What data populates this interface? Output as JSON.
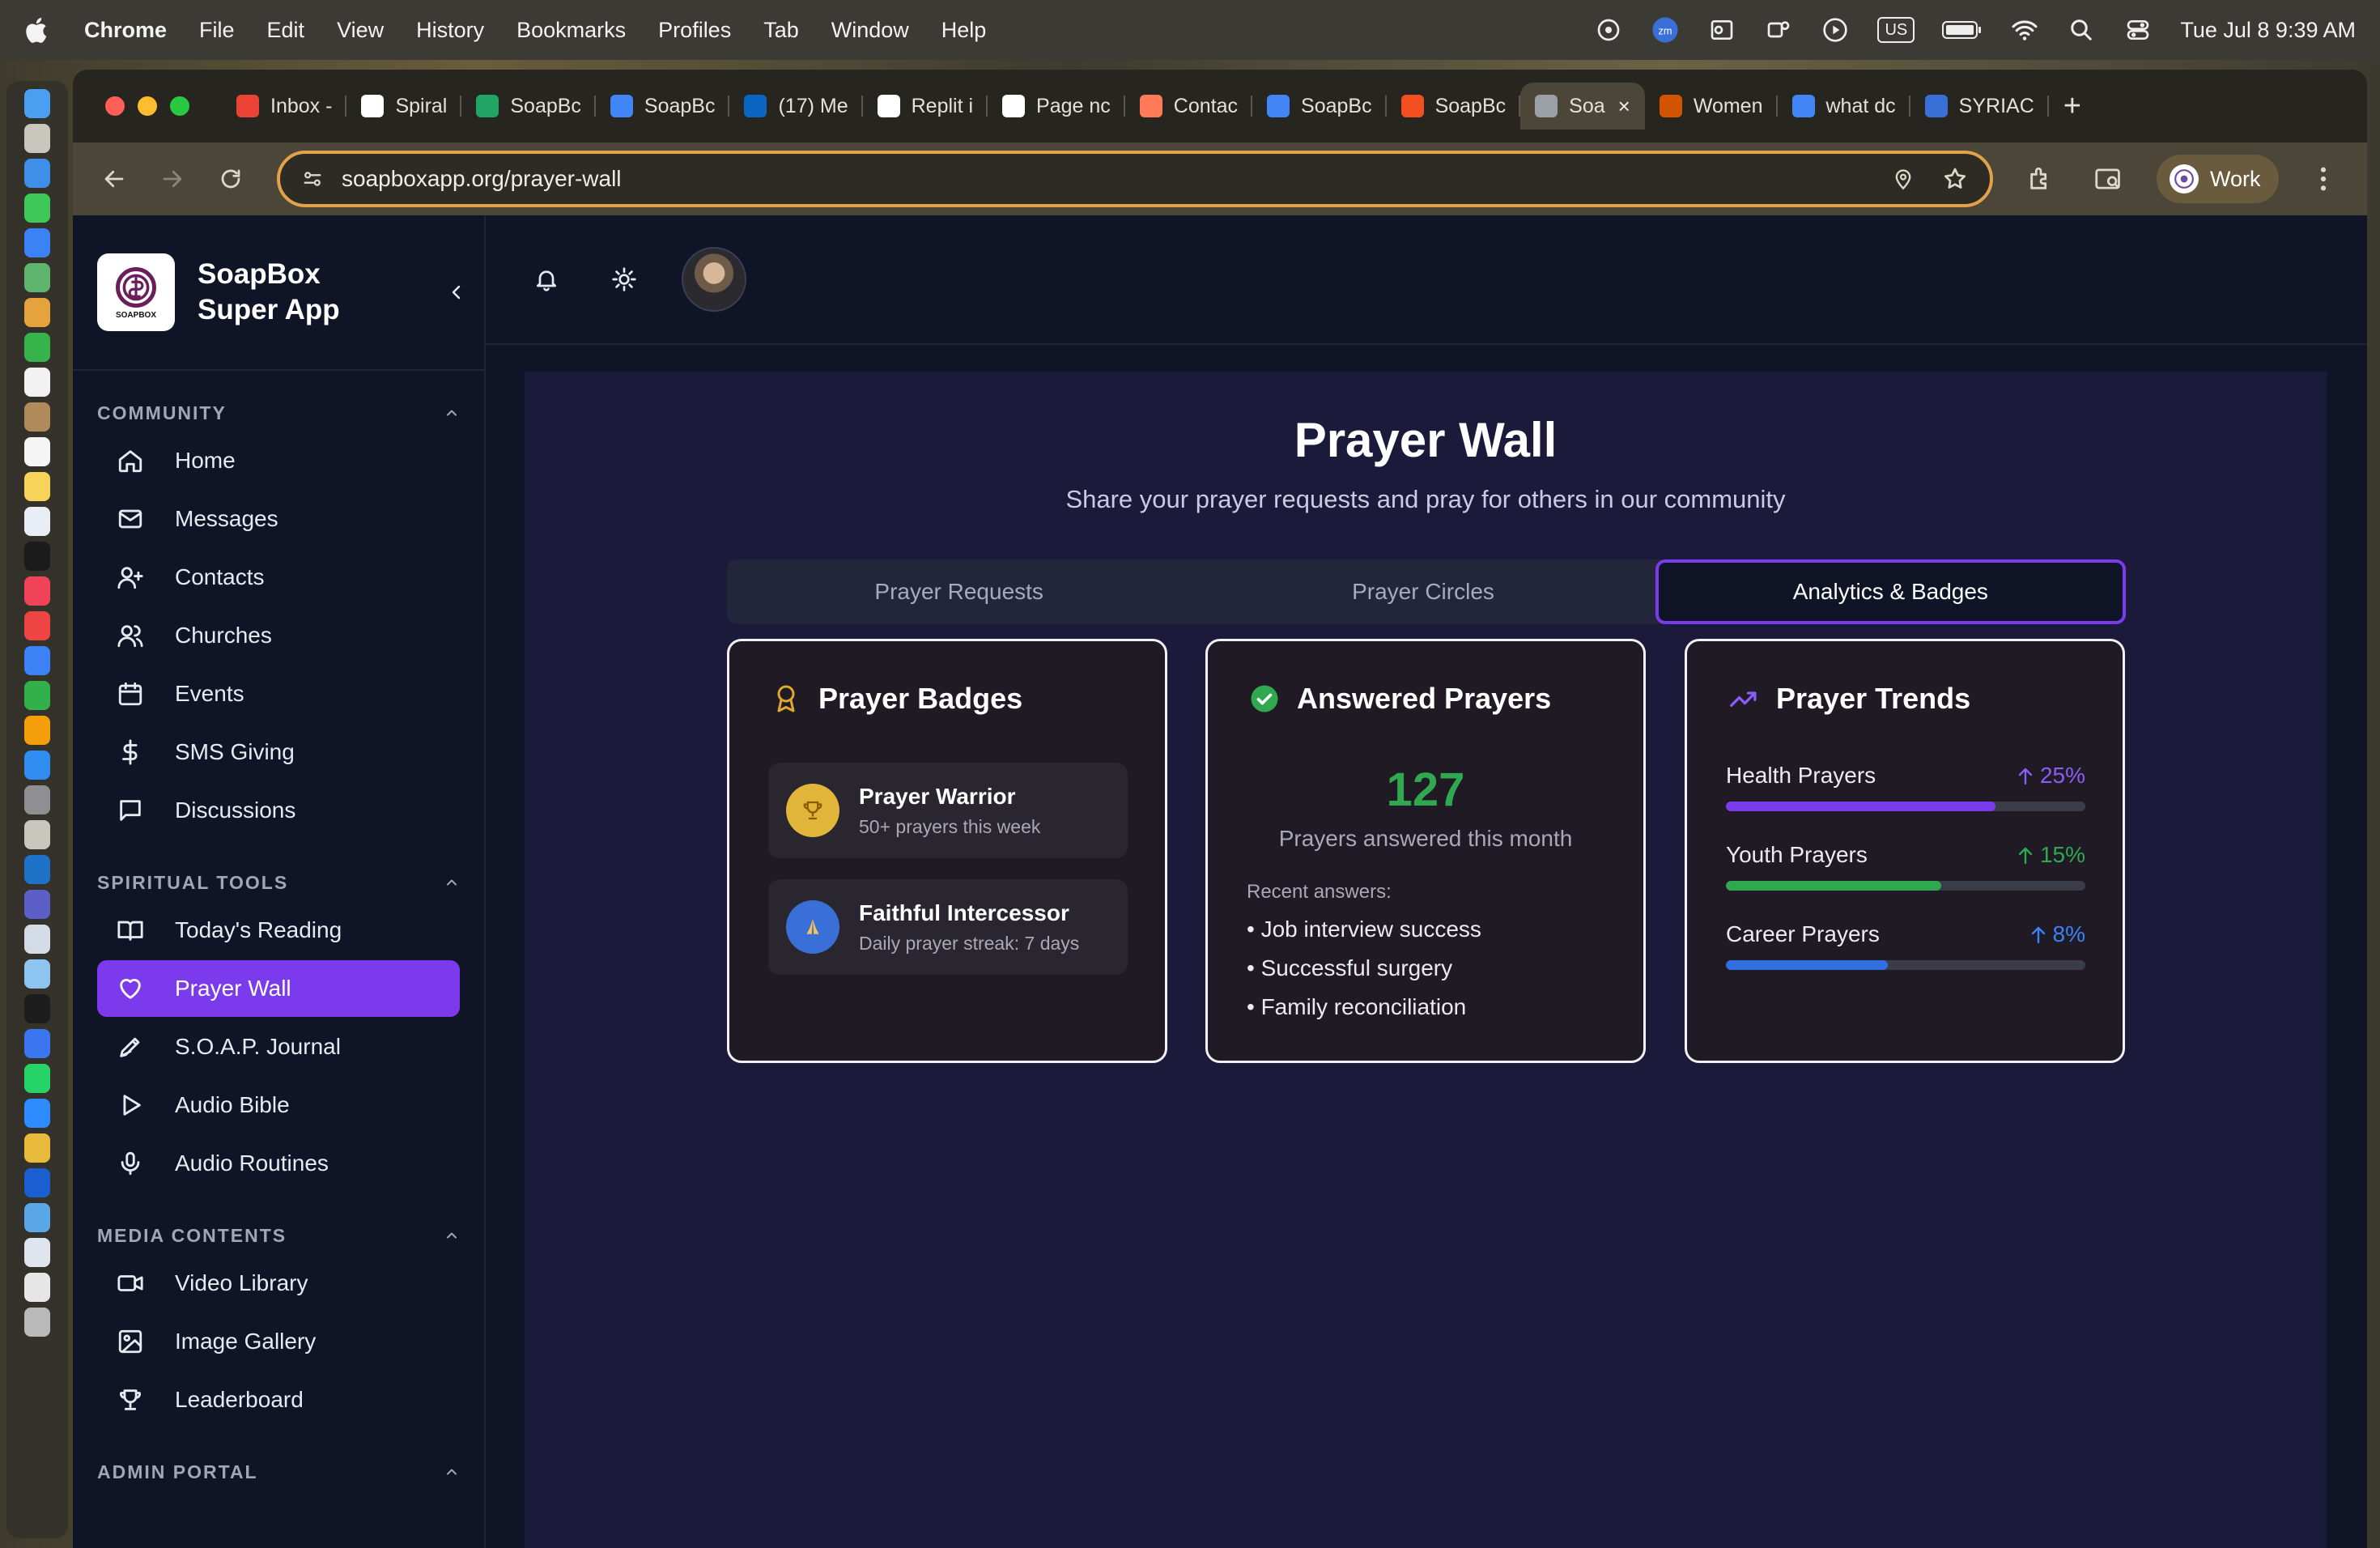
{
  "menubar": {
    "app": "Chrome",
    "items": [
      "File",
      "Edit",
      "View",
      "History",
      "Bookmarks",
      "Profiles",
      "Tab",
      "Window",
      "Help"
    ],
    "keyboard": "US",
    "clock": "Tue Jul 8  9:39 AM"
  },
  "tabs": [
    {
      "label": "Inbox -",
      "icon": "gmail-icon",
      "color": "#ea4335"
    },
    {
      "label": "Spiral",
      "icon": "spiral-icon",
      "color": "#ffffff"
    },
    {
      "label": "SoapBc",
      "icon": "sheets-icon",
      "color": "#21a464"
    },
    {
      "label": "SoapBc",
      "icon": "docs-icon",
      "color": "#4285f4"
    },
    {
      "label": "(17) Me",
      "icon": "linkedin-icon",
      "color": "#0a66c2"
    },
    {
      "label": "Replit i",
      "icon": "openai-icon",
      "color": "#ffffff"
    },
    {
      "label": "Page nc",
      "icon": "github-icon",
      "color": "#ffffff"
    },
    {
      "label": "Contac",
      "icon": "hubspot-icon",
      "color": "#ff7a59"
    },
    {
      "label": "SoapBc",
      "icon": "docs-icon",
      "color": "#4285f4"
    },
    {
      "label": "SoapBc",
      "icon": "figma-icon",
      "color": "#f24e1e"
    },
    {
      "label": "Soa",
      "icon": "globe-icon",
      "color": "#9aa0a6",
      "active": true
    },
    {
      "label": "Women",
      "icon": "page-icon",
      "color": "#d35400"
    },
    {
      "label": "what dc",
      "icon": "google-icon",
      "color": "#4285f4"
    },
    {
      "label": "SYRIAC",
      "icon": "td-icon",
      "color": "#3b6fd8"
    }
  ],
  "address": {
    "url": "soapboxapp.org/prayer-wall",
    "profile": "Work"
  },
  "brand": {
    "name": "SoapBox Super App",
    "logo_text": "SOAPBOX"
  },
  "sidebar": {
    "sections": [
      {
        "title": "COMMUNITY",
        "items": [
          {
            "label": "Home",
            "icon": "home-icon"
          },
          {
            "label": "Messages",
            "icon": "mail-icon"
          },
          {
            "label": "Contacts",
            "icon": "user-plus-icon"
          },
          {
            "label": "Churches",
            "icon": "users-icon"
          },
          {
            "label": "Events",
            "icon": "calendar-icon"
          },
          {
            "label": "SMS Giving",
            "icon": "dollar-icon"
          },
          {
            "label": "Discussions",
            "icon": "chat-icon"
          }
        ]
      },
      {
        "title": "SPIRITUAL TOOLS",
        "items": [
          {
            "label": "Today's Reading",
            "icon": "book-icon"
          },
          {
            "label": "Prayer Wall",
            "icon": "heart-icon",
            "active": true
          },
          {
            "label": "S.O.A.P. Journal",
            "icon": "pen-icon"
          },
          {
            "label": "Audio Bible",
            "icon": "play-icon"
          },
          {
            "label": "Audio Routines",
            "icon": "mic-icon"
          }
        ]
      },
      {
        "title": "MEDIA CONTENTS",
        "items": [
          {
            "label": "Video Library",
            "icon": "video-icon"
          },
          {
            "label": "Image Gallery",
            "icon": "image-icon"
          },
          {
            "label": "Leaderboard",
            "icon": "trophy-icon"
          }
        ]
      },
      {
        "title": "ADMIN PORTAL",
        "items": []
      }
    ]
  },
  "page": {
    "title": "Prayer Wall",
    "subtitle": "Share your prayer requests and pray for others in our community",
    "tabs": [
      "Prayer Requests",
      "Prayer Circles",
      "Analytics & Badges"
    ],
    "active_tab": "Analytics & Badges"
  },
  "badges_card": {
    "title": "Prayer Badges",
    "badges": [
      {
        "name": "Prayer Warrior",
        "desc": "50+ prayers this week",
        "icon": "trophy-icon",
        "color": "#e0b53a"
      },
      {
        "name": "Faithful Intercessor",
        "desc": "Daily prayer streak: 7 days",
        "icon": "praying-hands-icon",
        "color": "#3b6fd8"
      }
    ]
  },
  "answered_card": {
    "title": "Answered Prayers",
    "count": "127",
    "count_label": "Prayers answered this month",
    "recent_label": "Recent answers:",
    "recent": [
      "• Job interview success",
      "• Successful surgery",
      "• Family reconciliation"
    ]
  },
  "trends_card": {
    "title": "Prayer Trends",
    "trends": [
      {
        "label": "Health Prayers",
        "change": "25%",
        "color": "#7c3aed",
        "pct_color": "#8b5cf6",
        "level": 0.75
      },
      {
        "label": "Youth Prayers",
        "change": "15%",
        "color": "#2fa84f",
        "pct_color": "#2fa84f",
        "level": 0.6
      },
      {
        "label": "Career Prayers",
        "change": "8%",
        "color": "#2f6fe0",
        "pct_color": "#3b82f6",
        "level": 0.45
      }
    ]
  },
  "colors": {
    "accent": "#7c3aed",
    "success": "#2fa84f",
    "background": "#0f1526"
  }
}
